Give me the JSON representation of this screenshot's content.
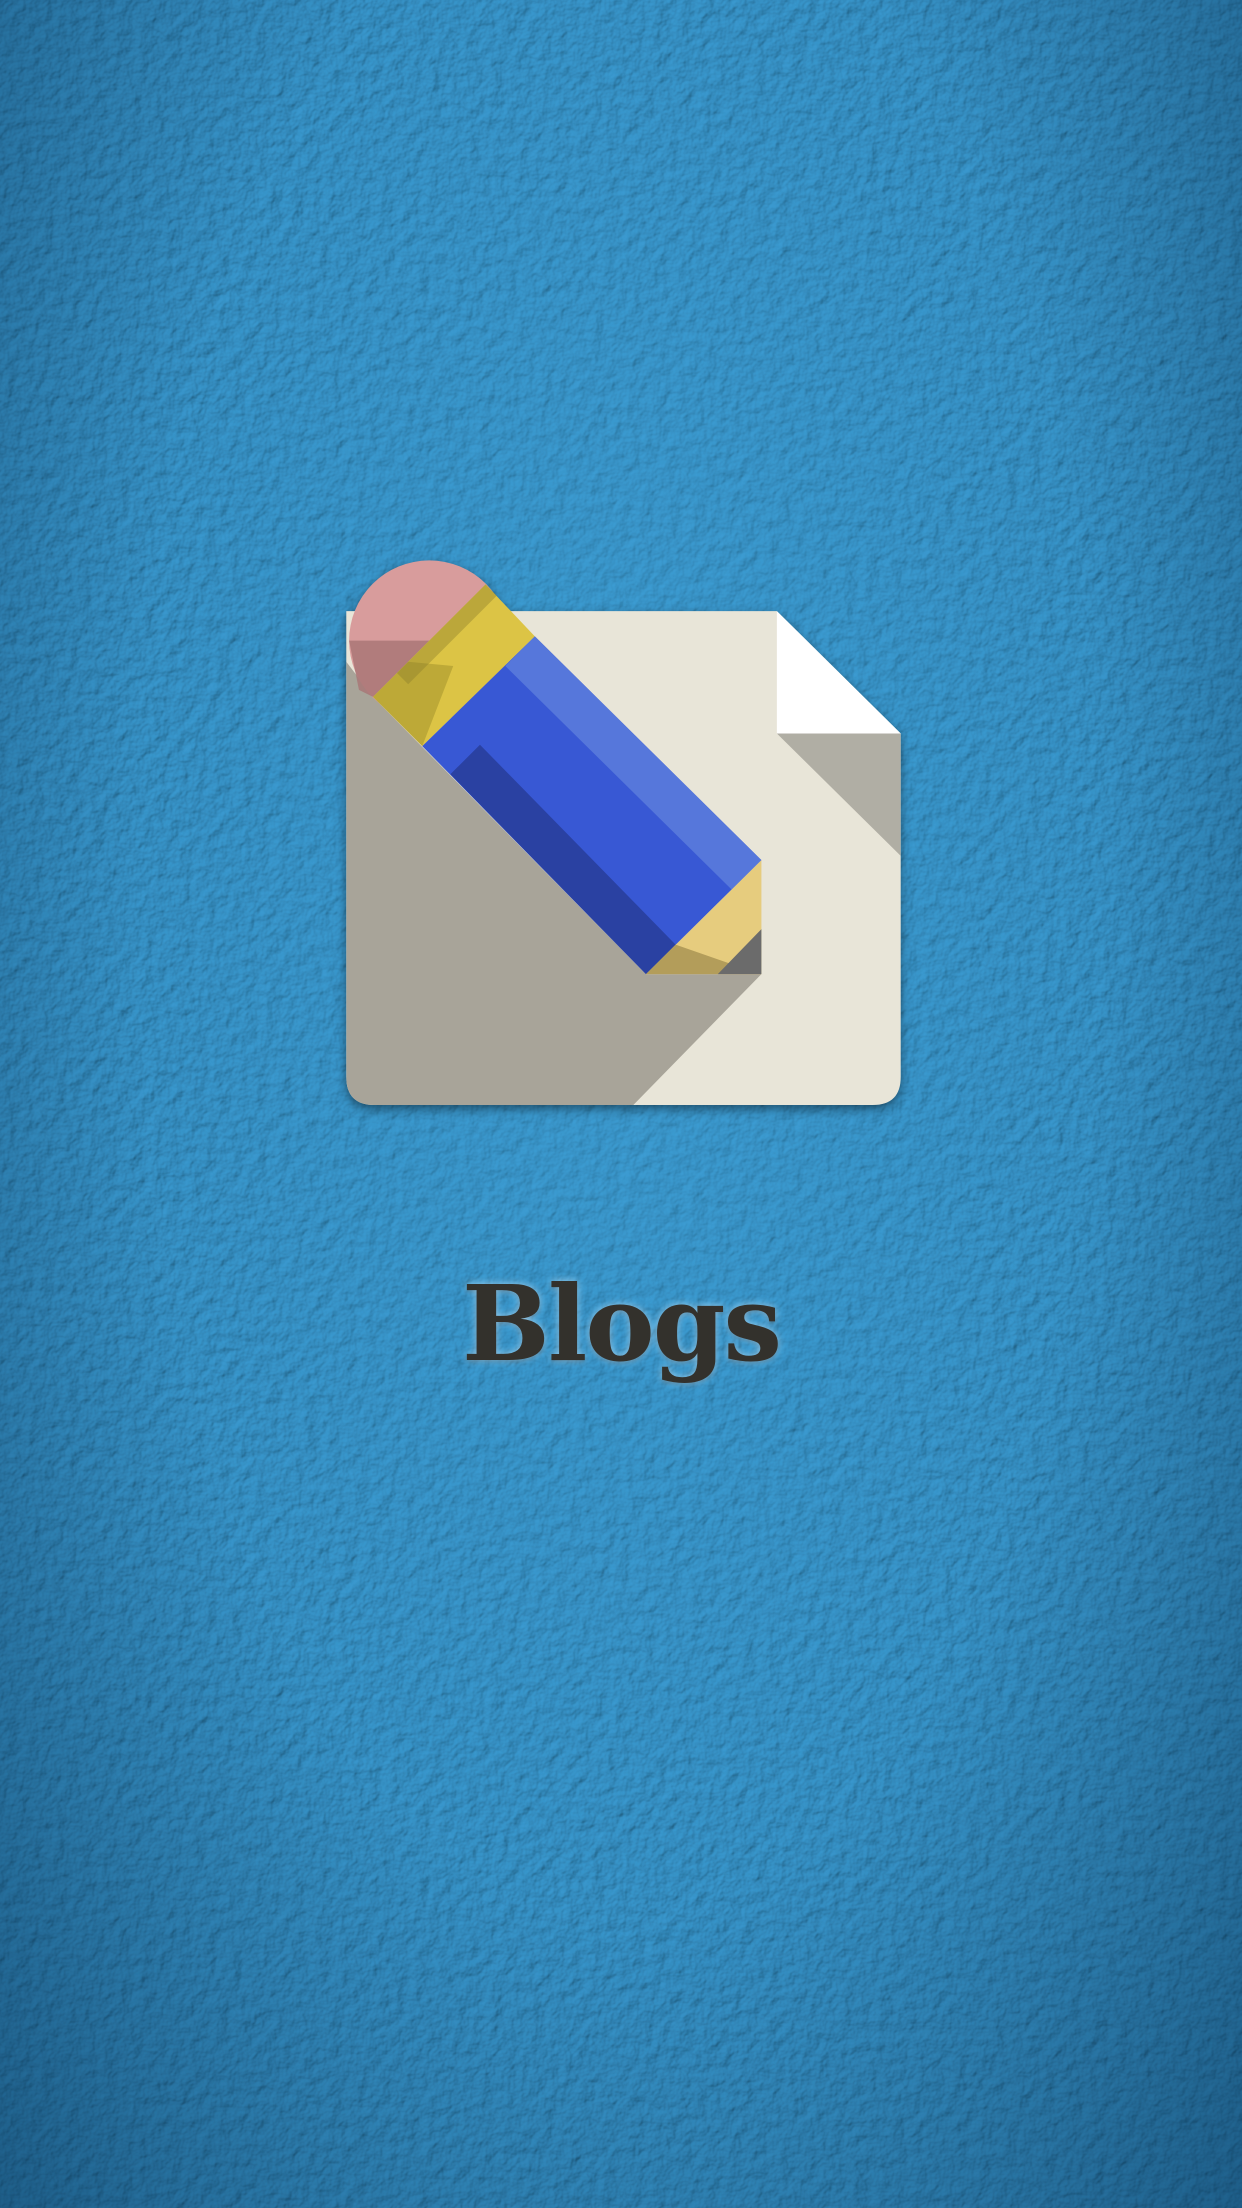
{
  "splash": {
    "app_name": "Blogs",
    "icon": "pencil-paper-icon"
  },
  "colors": {
    "background": "#2c8cc2",
    "paper": "#e8e5d8",
    "pencil_body": "#3858d4",
    "eraser": "#d89c9c",
    "ferrule": "#dcc445",
    "title_text": "#33312c"
  }
}
